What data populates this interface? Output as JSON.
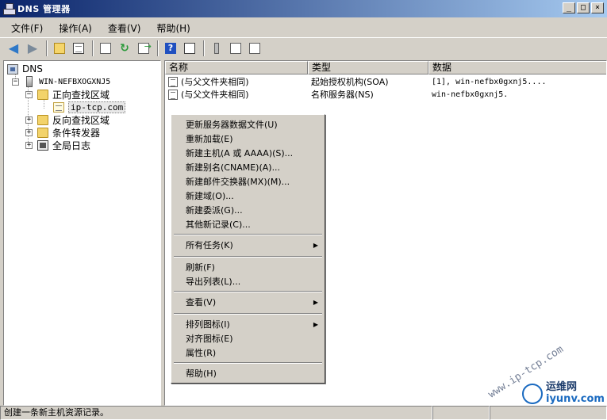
{
  "window": {
    "title": "DNS 管理器",
    "controls": [
      "_",
      "□",
      "×"
    ]
  },
  "menubar": [
    "文件(F)",
    "操作(A)",
    "查看(V)",
    "帮助(H)"
  ],
  "tree": {
    "root": "DNS",
    "server": "WIN-NEFBXOGXNJ5",
    "forward_zone": "正向查找区域",
    "zone": "ip-tcp.com",
    "reverse_zone": "反向查找区域",
    "forwarders": "条件转发器",
    "global_logs": "全局日志"
  },
  "table": {
    "headers": [
      "名称",
      "类型",
      "数据"
    ],
    "rows": [
      {
        "name": "(与父文件夹相同)",
        "type": "起始授权机构(SOA)",
        "data": "[1], win-nefbx0gxnj5...."
      },
      {
        "name": "(与父文件夹相同)",
        "type": "名称服务器(NS)",
        "data": "win-nefbx0gxnj5."
      }
    ]
  },
  "context_menu": {
    "group1": [
      "更新服务器数据文件(U)",
      "重新加载(E)",
      "新建主机(A 或 AAAA)(S)...",
      "新建别名(CNAME)(A)...",
      "新建邮件交换器(MX)(M)...",
      "新建域(O)...",
      "新建委派(G)...",
      "其他新记录(C)..."
    ],
    "all_tasks": "所有任务(K)",
    "group3": [
      "刷新(F)",
      "导出列表(L)..."
    ],
    "view": "查看(V)",
    "arrange": "排列图标(I)",
    "align": "对齐图标(E)",
    "properties": "属性(R)",
    "help": "帮助(H)"
  },
  "statusbar": {
    "text": "创建一条新主机资源记录。"
  },
  "watermark": {
    "diag": "www.ip-tcp.com",
    "name": "运维网",
    "url": "iyunv.com"
  }
}
